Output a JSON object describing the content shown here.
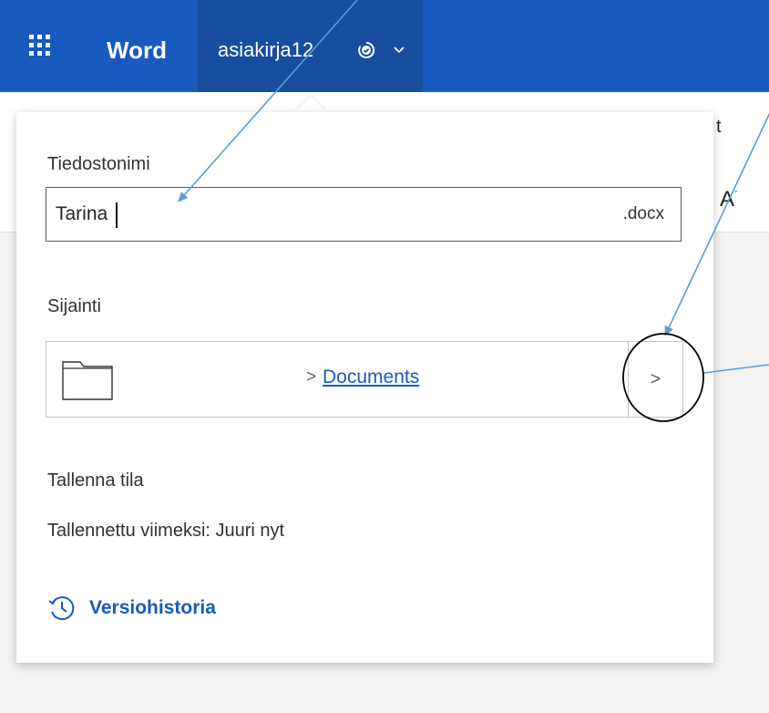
{
  "titlebar": {
    "app_name": "Word",
    "document_name": "asiakirja12",
    "waffle_icon": "app-launcher-icon",
    "saved_icon": "saved-check-icon",
    "chevron_icon": "chevron-down-icon",
    "accent": "#185abd",
    "tab_color": "#174e9f"
  },
  "ribbon_peek": {
    "text_1": "t",
    "text_2": "A",
    "text_2_sup": "ˇ"
  },
  "flyout": {
    "filename_label": "Tiedostonimi",
    "filename_value": "Tarina",
    "filename_extension": ".docx",
    "location_label": "Sijainti",
    "location_separator": ">",
    "location_folder": "Documents",
    "browse_button_label": ">",
    "save_state_label": "Tallenna tila",
    "last_saved_text": "Tallennettu viimeksi: Juuri nyt",
    "version_history_label": "Versiohistoria",
    "folder_icon": "folder-icon",
    "history_icon": "history-icon"
  },
  "annotations": {
    "color": "#5b9bd5",
    "circle_color": "#000000"
  }
}
